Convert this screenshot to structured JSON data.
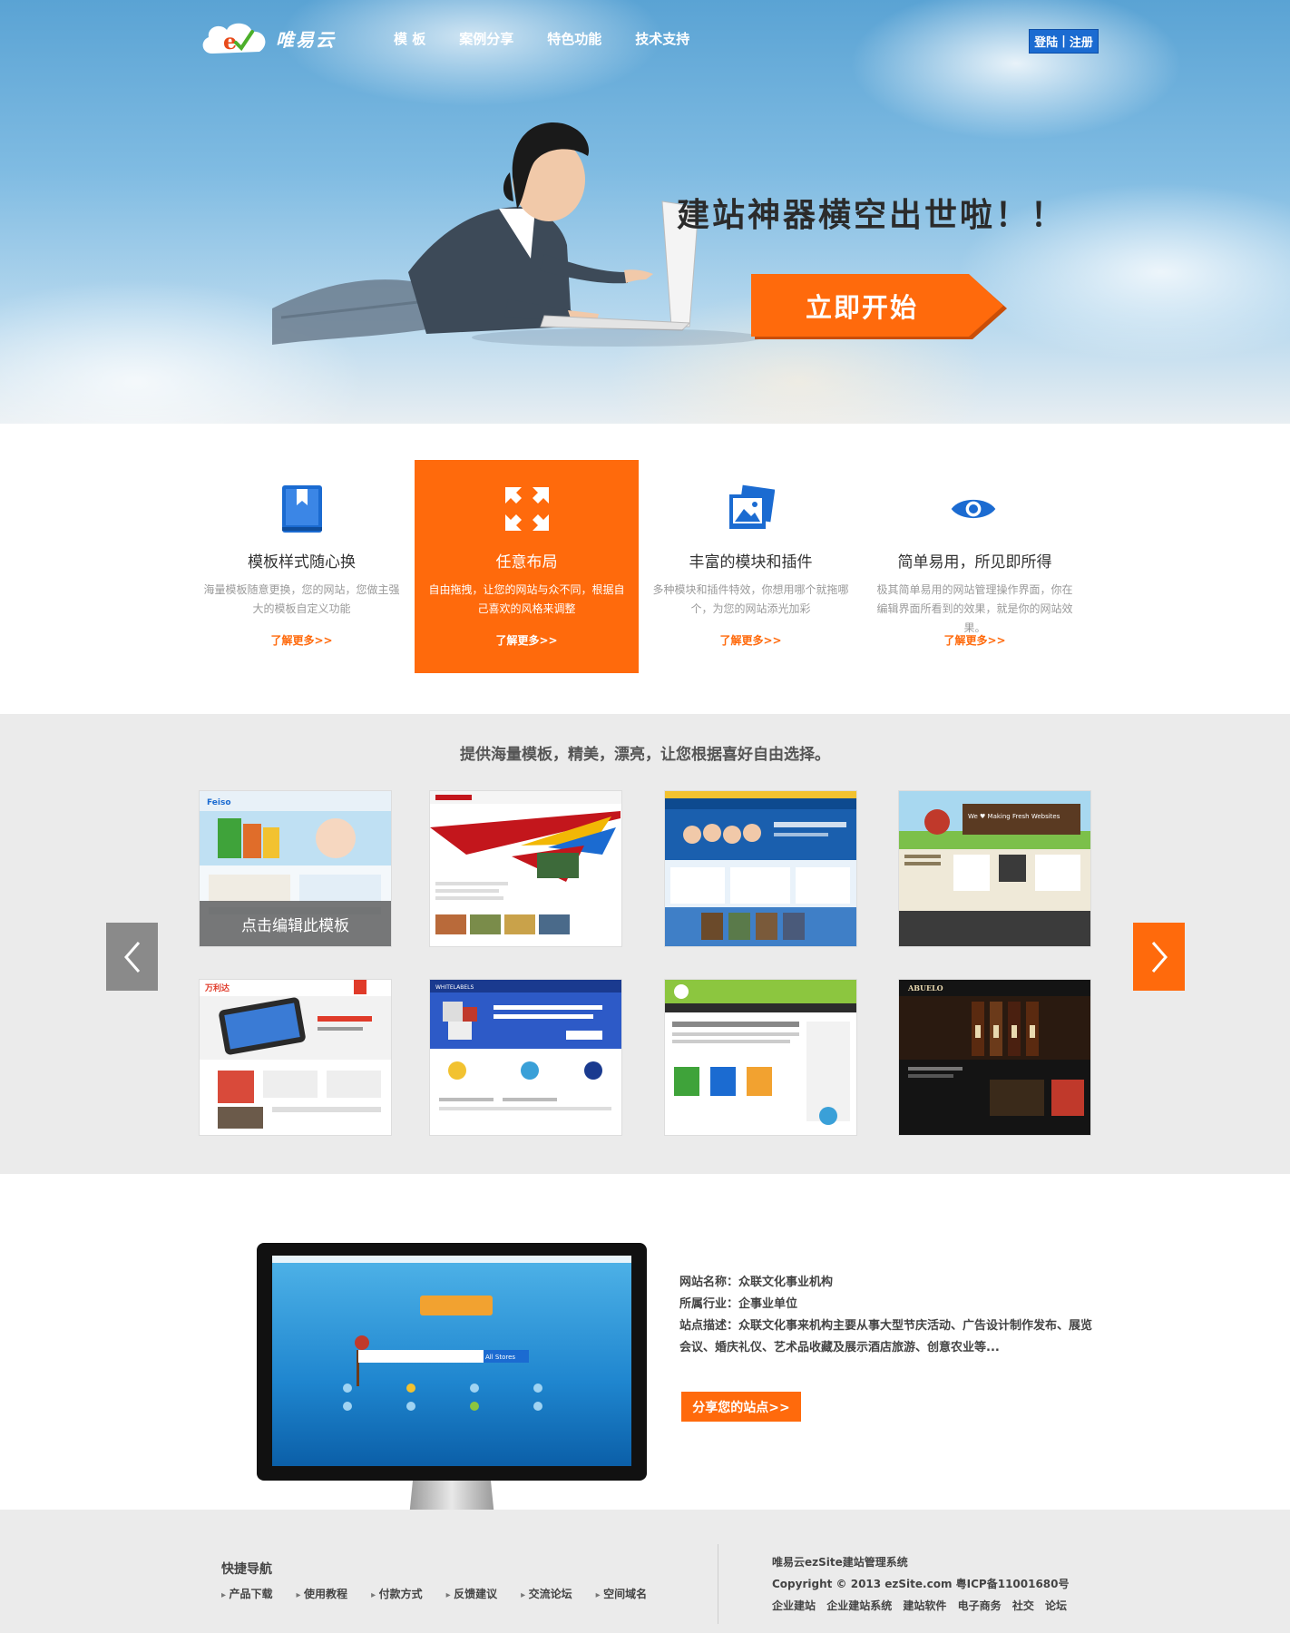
{
  "header": {
    "logo_text": "唯易云",
    "nav": [
      "模 板",
      "案例分享",
      "特色功能",
      "技术支持"
    ],
    "login": "登陆",
    "register": "注册",
    "separator": "|"
  },
  "hero": {
    "headline": "建站神器横空出世啦！！",
    "cta": "立即开始"
  },
  "features": [
    {
      "icon": "book-icon",
      "title": "模板样式随心换",
      "desc": "海量模板随意更换，您的网站，您做主强大的模板自定义功能",
      "more": "了解更多>>",
      "active": false
    },
    {
      "icon": "expand-arrows-icon",
      "title": "任意布局",
      "desc": "自由拖拽，让您的网站与众不同，根据自己喜欢的风格来调整",
      "more": "了解更多>>",
      "active": true
    },
    {
      "icon": "image-gallery-icon",
      "title": "丰富的模块和插件",
      "desc": "多种模块和插件特效，你想用哪个就拖哪个，为您的网站添光加彩",
      "more": "了解更多>>",
      "active": false
    },
    {
      "icon": "eye-icon",
      "title": "简单易用，所见即所得",
      "desc": "极其简单易用的网站管理操作界面，你在编辑界面所看到的效果，就是你的网站效果。",
      "more": "了解更多>>",
      "active": false
    }
  ],
  "templates": {
    "heading": "提供海量模板，精美，漂亮，让您根据喜好自由选择。",
    "overlay_label": "点击编辑此模板",
    "thumb_texts": {
      "feiso": "Feiso",
      "wanlida": "万利达",
      "whitelabels": "WHITELABELS",
      "abuelo": "ABUELO",
      "making": "We ♥ Making Fresh Websites"
    },
    "thumbs": [
      "template-feiso",
      "template-red-arrows",
      "template-education",
      "template-making-websites",
      "template-phone-store",
      "template-whitelabels",
      "template-green-software",
      "template-abuelo-wine"
    ]
  },
  "showcase": {
    "name_label": "网站名称：",
    "name": "众联文化事业机构",
    "industry_label": "所属行业：",
    "industry": "企事业单位",
    "desc_label": "站点描述：",
    "desc": "众联文化事来机构主要从事大型节庆活动、广告设计制作发布、展览会议、婚庆礼仪、艺术品收藏及展示酒店旅游、创意农业等...",
    "share": "分享您的站点>>",
    "screen_search_btn": "All Stores"
  },
  "footer": {
    "quick_nav_title": "快捷导航",
    "links": [
      "产品下载",
      "使用教程",
      "付款方式",
      "反馈建议",
      "交流论坛",
      "空间域名"
    ],
    "brand": "唯易云ezSite建站管理系统",
    "copyright": "Copyright © 2013 ezSite.com  粤ICP备11001680号",
    "tags": [
      "企业建站",
      "企业建站系统",
      "建站软件",
      "电子商务",
      "社交",
      "论坛"
    ]
  },
  "colors": {
    "accent": "#ff6a0c",
    "blue": "#1b6bd1",
    "gray_bg": "#ebebeb"
  }
}
